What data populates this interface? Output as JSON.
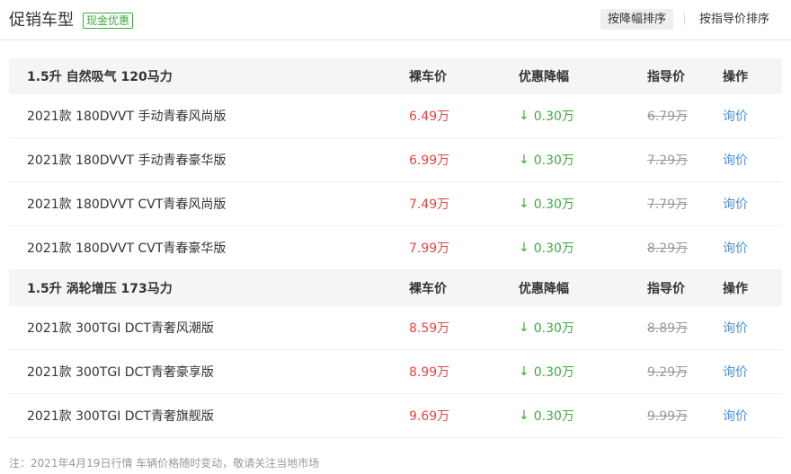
{
  "header": {
    "title": "促销车型",
    "badge": "现金优惠",
    "sort_discount": "按降幅排序",
    "sort_guide": "按指导价排序"
  },
  "columns": {
    "price": "裸车价",
    "discount": "优惠降幅",
    "guide": "指导价",
    "action": "操作"
  },
  "groups": [
    {
      "title": "1.5升 自然吸气 120马力",
      "rows": [
        {
          "name": "2021款 180DVVT 手动青春风尚版",
          "price": "6.49万",
          "discount": "0.30万",
          "guide": "6.79万",
          "action": "询价"
        },
        {
          "name": "2021款 180DVVT 手动青春豪华版",
          "price": "6.99万",
          "discount": "0.30万",
          "guide": "7.29万",
          "action": "询价"
        },
        {
          "name": "2021款 180DVVT CVT青春风尚版",
          "price": "7.49万",
          "discount": "0.30万",
          "guide": "7.79万",
          "action": "询价"
        },
        {
          "name": "2021款 180DVVT CVT青春豪华版",
          "price": "7.99万",
          "discount": "0.30万",
          "guide": "8.29万",
          "action": "询价"
        }
      ]
    },
    {
      "title": "1.5升 涡轮增压 173马力",
      "rows": [
        {
          "name": "2021款 300TGI DCT青奢风潮版",
          "price": "8.59万",
          "discount": "0.30万",
          "guide": "8.89万",
          "action": "询价"
        },
        {
          "name": "2021款 300TGI DCT青奢豪享版",
          "price": "8.99万",
          "discount": "0.30万",
          "guide": "9.29万",
          "action": "询价"
        },
        {
          "name": "2021款 300TGI DCT青奢旗舰版",
          "price": "9.69万",
          "discount": "0.30万",
          "guide": "9.99万",
          "action": "询价"
        }
      ]
    }
  ],
  "footnote": "注：2021年4月19日行情 车辆价格随时变动，敬请关注当地市场",
  "colors": {
    "price": "#e64545",
    "discount": "#3dab3d",
    "link": "#4a8fd8",
    "badge": "#3dab3d"
  },
  "icons": {
    "discount_arrow": "arrow-down-icon"
  }
}
